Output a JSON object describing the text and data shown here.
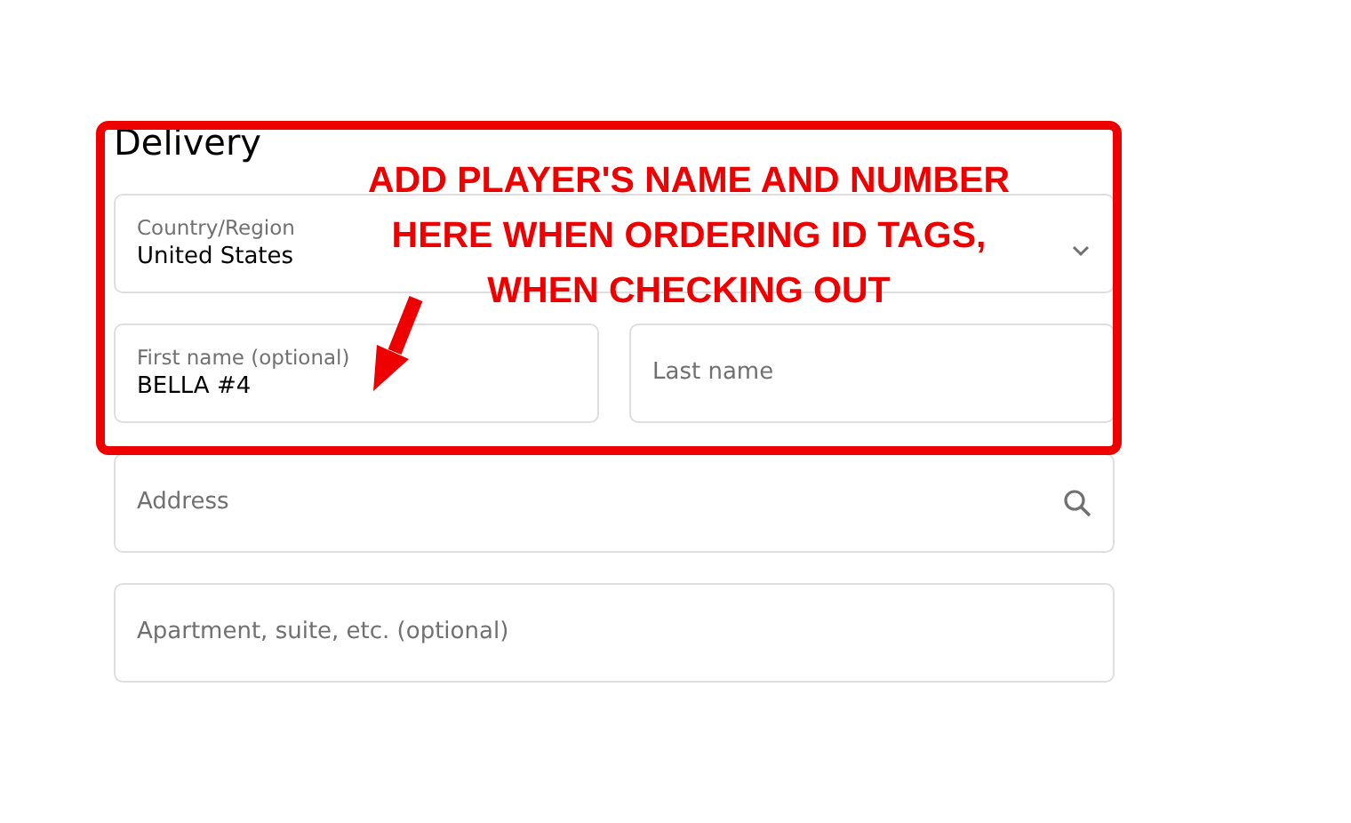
{
  "section_title": "Delivery",
  "fields": [
    {
      "kind": "select",
      "label": "Country/Region",
      "value": "United States"
    },
    {
      "kind": "text",
      "label": "First name (optional)",
      "value": "BELLA #4"
    },
    {
      "kind": "text",
      "placeholder": "Last name"
    },
    {
      "kind": "search",
      "placeholder": "Address"
    },
    {
      "kind": "text",
      "placeholder": "Apartment, suite, etc. (optional)"
    }
  ],
  "annotation": {
    "lines": [
      "ADD PLAYER'S NAME AND NUMBER",
      "HERE WHEN ORDERING ID TAGS,",
      "WHEN CHECKING OUT"
    ]
  }
}
